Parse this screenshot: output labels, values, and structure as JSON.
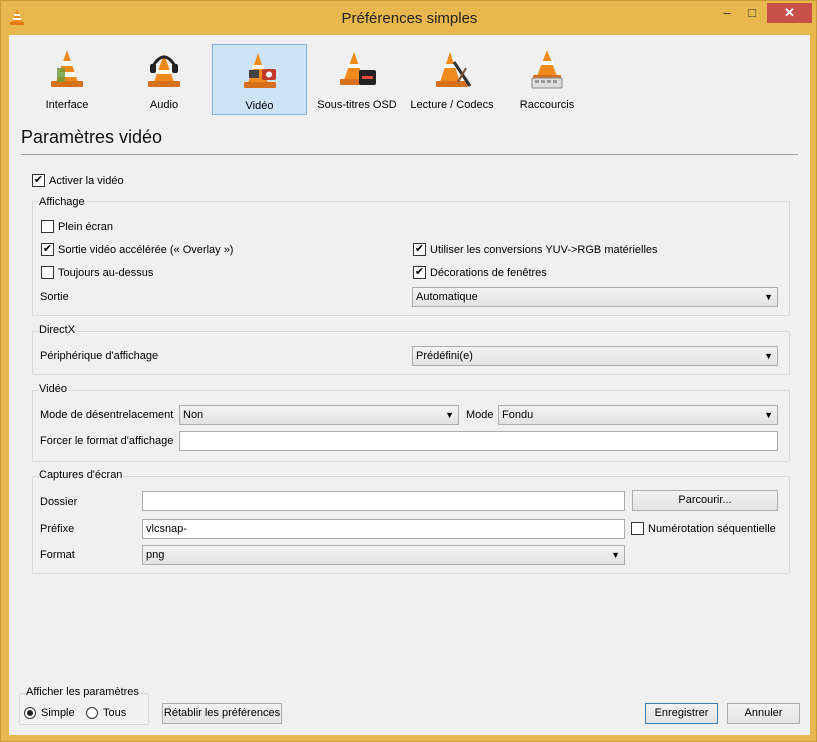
{
  "window": {
    "title": "Préférences simples"
  },
  "categories": [
    {
      "label": "Interface",
      "icon": "vlc-cone-icon",
      "selected": false
    },
    {
      "label": "Audio",
      "icon": "headphones-cone-icon",
      "selected": false
    },
    {
      "label": "Vidéo",
      "icon": "video-cone-icon",
      "selected": true
    },
    {
      "label": "Sous-titres  OSD",
      "icon": "subtitles-cone-icon",
      "selected": false
    },
    {
      "label": "Lecture / Codecs",
      "icon": "codecs-cone-icon",
      "selected": false
    },
    {
      "label": "Raccourcis",
      "icon": "keyboard-cone-icon",
      "selected": false
    }
  ],
  "page": {
    "title": "Paramètres vidéo"
  },
  "enable_video": {
    "label": "Activer la vidéo",
    "checked": true
  },
  "display": {
    "group_label": "Affichage",
    "fullscreen": {
      "label": "Plein écran",
      "checked": false
    },
    "overlay": {
      "label": "Sortie vidéo accélérée (« Overlay »)",
      "checked": true
    },
    "always_on_top": {
      "label": "Toujours au-dessus",
      "checked": false
    },
    "yuv_rgb": {
      "label": "Utiliser les conversions YUV->RGB matérielles",
      "checked": true
    },
    "decorations": {
      "label": "Décorations de fenêtres",
      "checked": true
    },
    "output_label": "Sortie",
    "output_value": "Automatique"
  },
  "directx": {
    "group_label": "DirectX",
    "device_label": "Périphérique d'affichage",
    "device_value": "Prédéfini(e)"
  },
  "video": {
    "group_label": "Vidéo",
    "deinterlace_label": "Mode de désentrelacement",
    "deinterlace_value": "Non",
    "mode_label": "Mode",
    "mode_value": "Fondu",
    "aspect_label": "Forcer le format d'affichage",
    "aspect_value": ""
  },
  "snapshots": {
    "group_label": "Captures d'écran",
    "folder_label": "Dossier",
    "folder_value": "",
    "browse_label": "Parcourir...",
    "prefix_label": "Préfixe",
    "prefix_value": "vlcsnap-",
    "sequential_label": "Numérotation séquentielle",
    "sequential_checked": false,
    "format_label": "Format",
    "format_value": "png"
  },
  "footer": {
    "show_settings_label": "Afficher les paramètres",
    "simple_label": "Simple",
    "all_label": "Tous",
    "reset_label": "Rétablir les préférences",
    "save_label": "Enregistrer",
    "cancel_label": "Annuler"
  },
  "colors": {
    "titlebar": "#e8b84f",
    "selected_tab": "#cde3f7",
    "close_button": "#c7504b",
    "default_button_border": "#3c7fb1"
  }
}
